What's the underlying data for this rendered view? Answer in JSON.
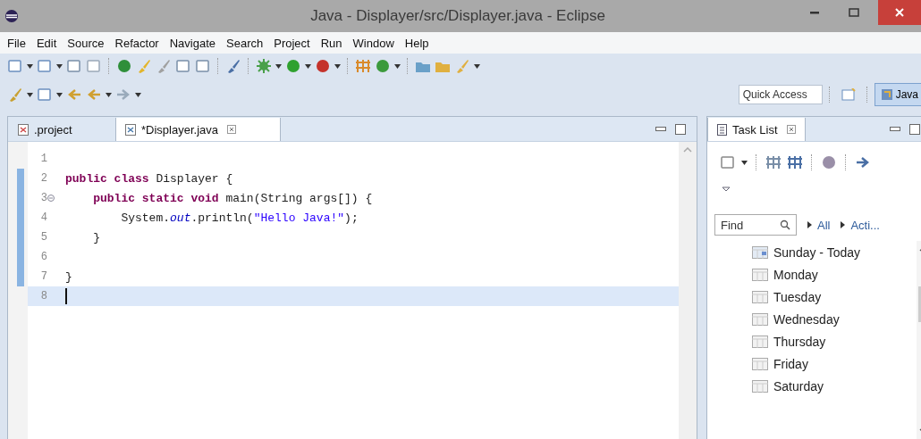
{
  "window": {
    "title": "Java - Displayer/src/Displayer.java - Eclipse"
  },
  "menu": [
    "File",
    "Edit",
    "Source",
    "Refactor",
    "Navigate",
    "Search",
    "Project",
    "Run",
    "Window",
    "Help"
  ],
  "quick_access": {
    "placeholder": "Quick Access"
  },
  "perspective": {
    "label": "Java",
    "selected": true
  },
  "editor": {
    "tabs": [
      {
        "label": ".project",
        "selected": false
      },
      {
        "label": "*Displayer.java",
        "selected": true
      }
    ],
    "lines": [
      {
        "number": "1",
        "changed": false,
        "fold": false,
        "current": false
      },
      {
        "number": "2",
        "changed": true,
        "fold": false,
        "current": false,
        "segments": [
          {
            "kind": "keyword",
            "text": "public class"
          },
          {
            "kind": "plain",
            "text": " Displayer {"
          }
        ]
      },
      {
        "number": "3",
        "changed": true,
        "fold": true,
        "current": false,
        "segments": [
          {
            "kind": "keyword",
            "text": "    public static void"
          },
          {
            "kind": "plain",
            "text": " main(String args[]) {"
          }
        ]
      },
      {
        "number": "4",
        "changed": true,
        "fold": false,
        "current": false,
        "segments": [
          {
            "kind": "plain",
            "text": "        System."
          },
          {
            "kind": "field",
            "text": "out"
          },
          {
            "kind": "plain",
            "text": ".println("
          },
          {
            "kind": "string",
            "text": "\"Hello Java!\""
          },
          {
            "kind": "plain",
            "text": ");"
          }
        ]
      },
      {
        "number": "5",
        "changed": true,
        "fold": false,
        "current": false,
        "segments": [
          {
            "kind": "plain",
            "text": "    }"
          }
        ]
      },
      {
        "number": "6",
        "changed": true,
        "fold": false,
        "current": false
      },
      {
        "number": "7",
        "changed": true,
        "fold": false,
        "current": false,
        "segments": [
          {
            "kind": "plain",
            "text": "}"
          }
        ]
      },
      {
        "number": "8",
        "changed": false,
        "fold": false,
        "current": true
      }
    ]
  },
  "task_list": {
    "title": "Task List",
    "find": {
      "placeholder": "Find"
    },
    "filters": [
      "All",
      "Acti..."
    ],
    "days": [
      {
        "label": "Sunday - Today",
        "kind": "today"
      },
      {
        "label": "Monday",
        "kind": "day"
      },
      {
        "label": "Tuesday",
        "kind": "day"
      },
      {
        "label": "Wednesday",
        "kind": "day"
      },
      {
        "label": "Thursday",
        "kind": "day"
      },
      {
        "label": "Friday",
        "kind": "day"
      },
      {
        "label": "Saturday",
        "kind": "day"
      }
    ]
  }
}
